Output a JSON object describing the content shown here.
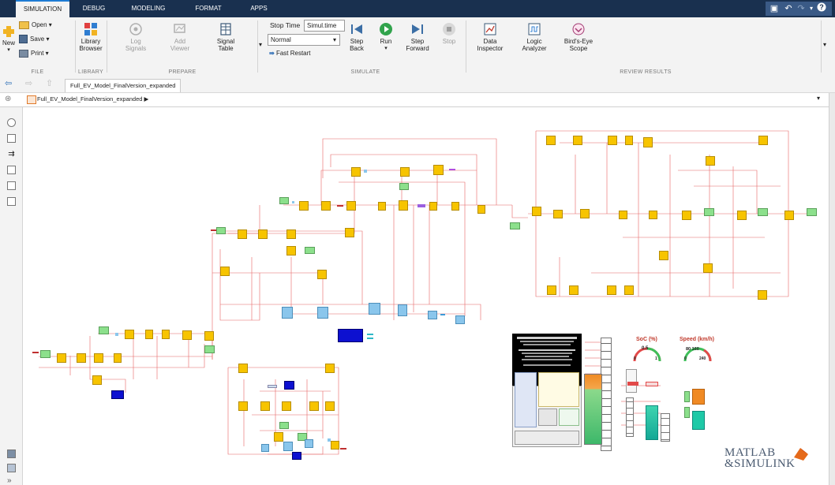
{
  "window_tabs": [
    "SIMULATION",
    "DEBUG",
    "MODELING",
    "FORMAT",
    "APPS"
  ],
  "active_tab": "SIMULATION",
  "ribbon": {
    "file": {
      "new_label": "New",
      "open_label": "Open",
      "save_label": "Save",
      "print_label": "Print",
      "group_title": "FILE"
    },
    "library": {
      "library_browser_line1": "Library",
      "library_browser_line2": "Browser",
      "group_title": "LIBRARY"
    },
    "prepare": {
      "log_signals_line1": "Log",
      "log_signals_line2": "Signals",
      "add_viewer_line1": "Add",
      "add_viewer_line2": "Viewer",
      "signal_table_line1": "Signal",
      "signal_table_line2": "Table",
      "group_title": "PREPARE"
    },
    "simulate": {
      "stop_time_label": "Stop Time",
      "stop_time_value": "Simul.time",
      "mode_value": "Normal",
      "fast_restart_label": "Fast Restart",
      "step_back_line1": "Step",
      "step_back_line2": "Back",
      "run_label": "Run",
      "step_forward_line1": "Step",
      "step_forward_line2": "Forward",
      "stop_label": "Stop",
      "group_title": "SIMULATE"
    },
    "review": {
      "data_inspector_line1": "Data",
      "data_inspector_line2": "Inspector",
      "logic_analyzer_line1": "Logic",
      "logic_analyzer_line2": "Analyzer",
      "birds_eye_line1": "Bird's-Eye",
      "birds_eye_line2": "Scope",
      "group_title": "REVIEW RESULTS"
    }
  },
  "model_tab": "Full_EV_Model_FinalVersion_expanded",
  "breadcrumb": "Full_EV_Model_FinalVersion_expanded",
  "dashboard": {
    "soc_title": "SoC (%)",
    "soc_value": "0.5",
    "soc_min": "0",
    "soc_max": "1",
    "speed_title": "Speed (km/h)",
    "speed_value_a": "80",
    "speed_value_b": "160",
    "speed_min": "0",
    "speed_max": "240"
  },
  "logo": {
    "line1": "MATLAB",
    "line2": "&SIMULINK"
  },
  "colors": {
    "titlebar": "#19304f",
    "accent": "#1e7bd4",
    "block_yellow": "#f7c400",
    "block_green": "#8ce08c",
    "block_blue": "#8ac6ec",
    "block_darkblue": "#0d10d0",
    "wire_red": "#e24a4a"
  }
}
